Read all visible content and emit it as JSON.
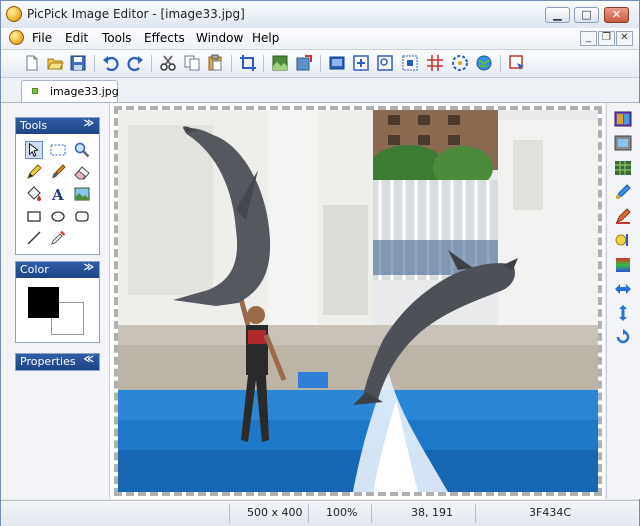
{
  "window": {
    "title": "PicPick Image Editor - [image33.jpg]",
    "caption_buttons": [
      "minimize",
      "restore",
      "close"
    ]
  },
  "menu": {
    "items": [
      {
        "label": "File"
      },
      {
        "label": "Edit"
      },
      {
        "label": "Tools"
      },
      {
        "label": "Effects"
      },
      {
        "label": "Window"
      },
      {
        "label": "Help"
      }
    ],
    "mdi_buttons": [
      "minimize",
      "restore",
      "close"
    ]
  },
  "toolbar": {
    "buttons": [
      "new-icon",
      "open-icon",
      "save-icon",
      "undo-icon",
      "redo-icon",
      "cut-icon",
      "copy-icon",
      "paste-icon",
      "crop-icon",
      "resize-icon",
      "rotate-icon",
      "frame-icon",
      "insert-icon",
      "zoom-icon",
      "select-icon",
      "grid-icon",
      "color-wheel-icon",
      "globe-icon",
      "capture-icon"
    ]
  },
  "tabs": [
    {
      "label": "image33.jpg",
      "active": true
    }
  ],
  "tools_panel": {
    "title": "Tools",
    "tools": [
      "pointer-icon",
      "rect-select-icon",
      "zoom-icon",
      "pencil-icon",
      "brush-icon",
      "eraser-icon",
      "fill-icon",
      "text-icon",
      "image-stamp-icon",
      "rectangle-icon",
      "ellipse-icon",
      "rounded-rect-icon",
      "line-icon",
      "eyedropper-icon"
    ],
    "selected": "pointer-icon"
  },
  "color_panel": {
    "title": "Color",
    "foreground": "#000000",
    "background": "#ffffff"
  },
  "properties_panel": {
    "title": "Properties"
  },
  "right_toolbar": {
    "buttons": [
      "effects-icon",
      "frame-icon",
      "mosaic-icon",
      "brightness-icon",
      "sharpen-icon",
      "highlight-icon",
      "gradient-icon",
      "flip-horizontal-icon",
      "flip-vertical-icon",
      "rotate-icon"
    ]
  },
  "status": {
    "image_size": "500 x 400",
    "zoom": "100%",
    "cursor_position": "38, 191",
    "color_hex": "3F434C"
  },
  "colors": {
    "panel_header": "#1d4585",
    "accent": "#2f5ea8"
  }
}
